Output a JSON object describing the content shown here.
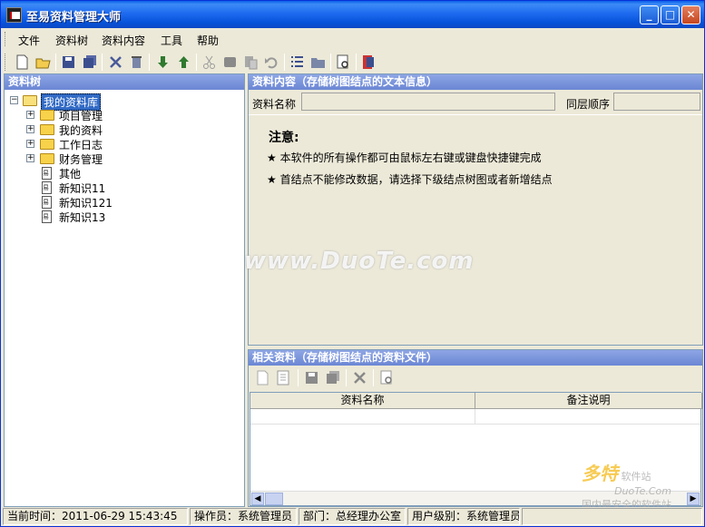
{
  "window": {
    "title": "至易资料管理大师"
  },
  "menu": [
    "文件",
    "资料树",
    "资料内容",
    "工具",
    "帮助"
  ],
  "toolbar_icons": [
    "new-icon",
    "open-icon",
    "save-icon",
    "save-all-icon",
    "delete-icon",
    "trash-icon",
    "move-down-icon",
    "move-up-icon",
    "cut-icon",
    "copy-icon",
    "paste-icon",
    "undo-icon",
    "list-icon",
    "folder-icon",
    "preview-icon",
    "exit-icon"
  ],
  "tree": {
    "header": "资料树",
    "root": "我的资料库",
    "folders": [
      "项目管理",
      "我的资料",
      "工作日志",
      "财务管理"
    ],
    "docs": [
      "其他",
      "新知识11",
      "新知识121",
      "新知识13"
    ]
  },
  "content": {
    "header": "资料内容（存储树图结点的文本信息）",
    "name_label": "资料名称",
    "order_label": "同层顺序",
    "name_value": "",
    "order_value": "",
    "note_title": "注意:",
    "notes": [
      "★  本软件的所有操作都可由鼠标左右键或键盘快捷键完成",
      "★  首结点不能修改数据，请选择下级结点树图或者新增结点"
    ]
  },
  "related": {
    "header": "相关资料（存储树图结点的资料文件）",
    "columns": [
      "资料名称",
      "备注说明"
    ]
  },
  "status": {
    "time": "当前时间：2011-06-29 15:43:45",
    "operator": "操作员：系统管理员",
    "dept": "部门：总经理办公室",
    "level": "用户级别：系统管理员"
  },
  "watermark": {
    "main": "www.DuoTe.com",
    "logo": "多特",
    "logo_sub": "软件站",
    "site": "DuoTe.Com",
    "slogan": "国内最安全的软件站"
  }
}
